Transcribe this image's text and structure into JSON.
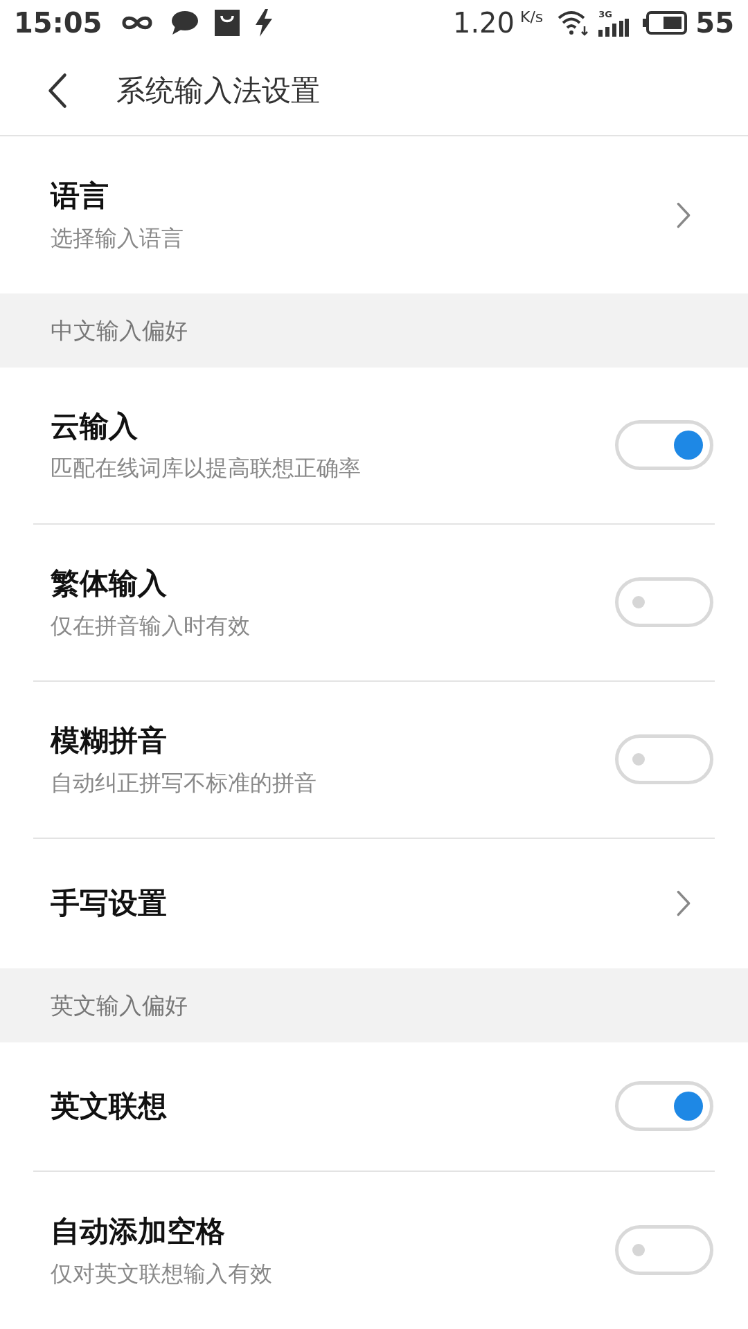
{
  "status_bar": {
    "time": "15:05",
    "speed": "1.20",
    "speed_unit": "K/s",
    "network": "3G",
    "battery": "55"
  },
  "header": {
    "title": "系统输入法设置"
  },
  "items": [
    {
      "kind": "link",
      "title": "语言",
      "subtitle": "选择输入语言"
    },
    {
      "kind": "section",
      "title": "中文输入偏好"
    },
    {
      "kind": "toggle",
      "title": "云输入",
      "subtitle": "匹配在线词库以提高联想正确率",
      "on": true
    },
    {
      "kind": "toggle",
      "title": "繁体输入",
      "subtitle": "仅在拼音输入时有效",
      "on": false
    },
    {
      "kind": "toggle",
      "title": "模糊拼音",
      "subtitle": "自动纠正拼写不标准的拼音",
      "on": false
    },
    {
      "kind": "link",
      "title": "手写设置"
    },
    {
      "kind": "section",
      "title": "英文输入偏好"
    },
    {
      "kind": "toggle",
      "title": "英文联想",
      "on": true
    },
    {
      "kind": "toggle",
      "title": "自动添加空格",
      "subtitle": "仅对英文联想输入有效",
      "on": false
    }
  ]
}
